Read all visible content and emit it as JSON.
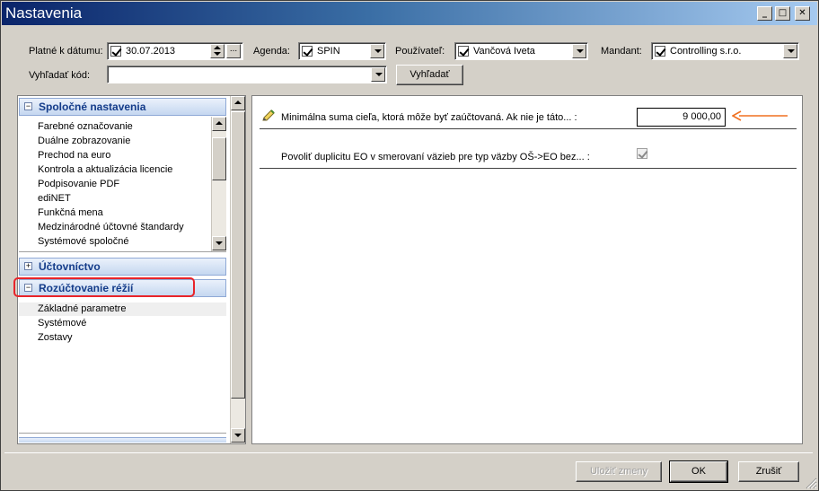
{
  "window": {
    "title": "Nastavenia"
  },
  "titlebar_buttons": {
    "minimize": "_",
    "maximize": "□",
    "close": "✕"
  },
  "filters": {
    "date_label": "Platné k dátumu:",
    "date_value": "30.07.2013",
    "date_more": "...",
    "agenda_label": "Agenda:",
    "agenda_value": "SPIN",
    "user_label": "Používateľ:",
    "user_value": "Vančová Iveta",
    "mandant_label": "Mandant:",
    "mandant_value": "Controlling s.r.o.",
    "search_label": "Vyhľadať kód:",
    "search_value": "",
    "search_button": "Vyhľadať"
  },
  "sidebar": {
    "groups": [
      {
        "label": "Spoločné nastavenia",
        "expanded": true,
        "items": [
          "Farebné označovanie",
          "Duálne zobrazovanie",
          "Prechod na euro",
          "Kontrola a aktualizácia licencie",
          "Podpisovanie PDF",
          "ediNET",
          "Funkčná mena",
          "Medzinárodné účtovné štandardy",
          "Systémové spoločné"
        ]
      },
      {
        "label": "Účtovníctvo",
        "expanded": false,
        "items": []
      },
      {
        "label": "Rozúčtovanie réžií",
        "expanded": true,
        "items": [
          "Základné parametre",
          "Systémové",
          "Zostavy"
        ]
      }
    ]
  },
  "settings": {
    "row1_label": "Minimálna suma cieľa, ktorá môže byť zaúčtovaná. Ak nie je táto... :",
    "row1_value": "9 000,00",
    "row2_label": "Povoliť duplicitu EO  v smerovaní väzieb pre typ väzby OŠ->EO  bez... :",
    "row2_checked": true
  },
  "footer": {
    "save_label": "Uložiť zmeny",
    "ok_label": "OK",
    "cancel_label": "Zrušiť"
  },
  "colors": {
    "accent_arrow": "#f07020",
    "highlight": "#e8242a",
    "group_header_text": "#143c8a"
  }
}
